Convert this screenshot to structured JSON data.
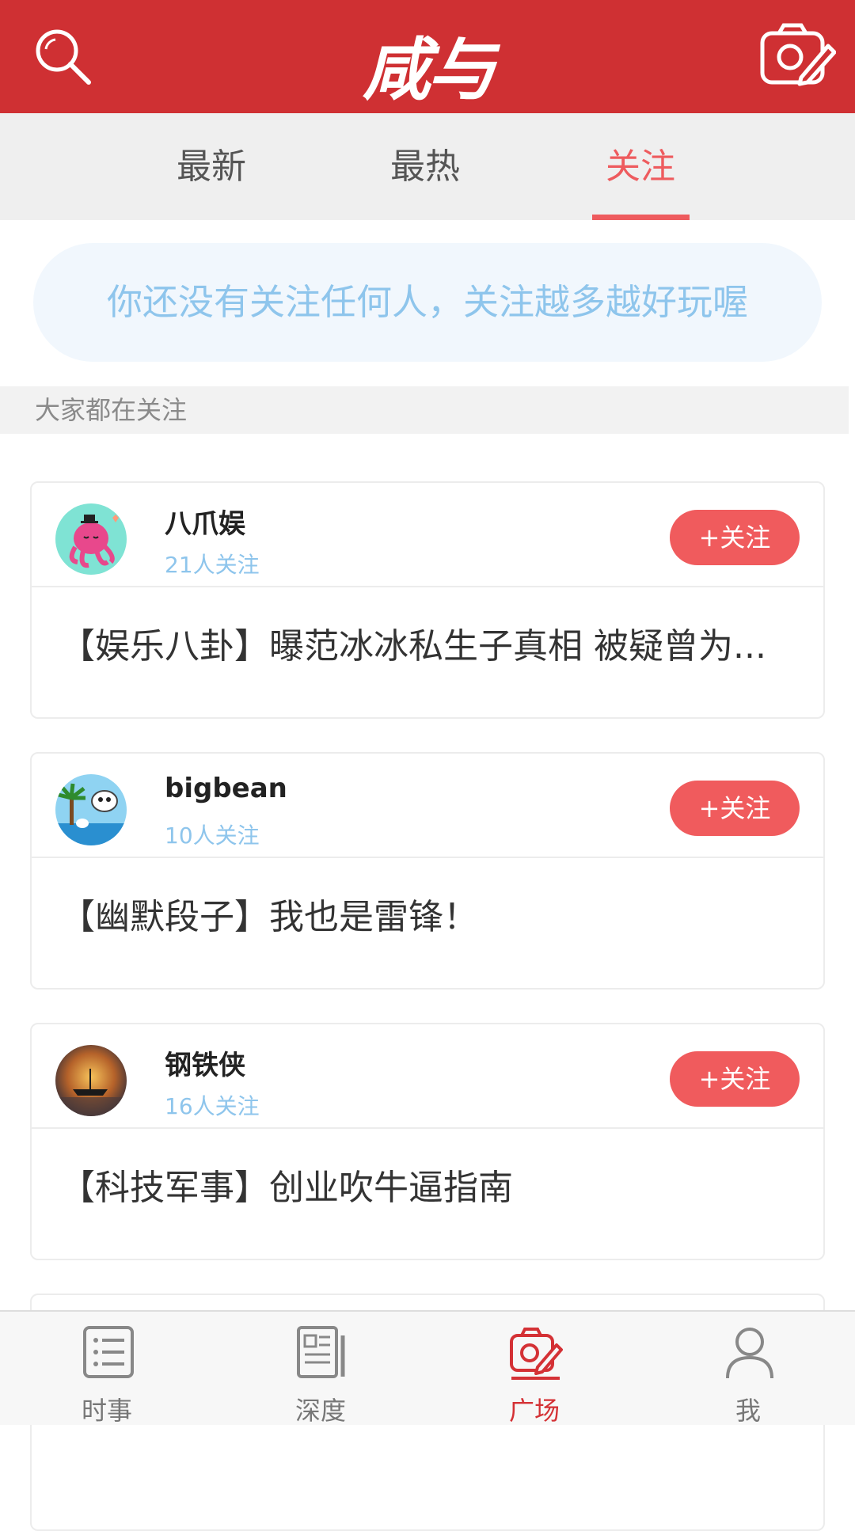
{
  "header": {
    "logo": "咸与",
    "search_icon": "search-icon",
    "camera_icon": "camera-edit-icon",
    "bg_color": "#cf3033"
  },
  "tabs": [
    {
      "label": "最新",
      "active": false
    },
    {
      "label": "最热",
      "active": false
    },
    {
      "label": "关注",
      "active": true
    }
  ],
  "hint": "你还没有关注任何人，关注越多越好玩喔",
  "section_title": "大家都在关注",
  "cards": [
    {
      "name": "八爪娱",
      "followers": "21人关注",
      "follow_label": "+关注",
      "title": "【娱乐八卦】曝范冰冰私生子真相 被疑曾为..."
    },
    {
      "name": "bigbean",
      "followers": "10人关注",
      "follow_label": "+关注",
      "title": "【幽默段子】我也是雷锋！"
    },
    {
      "name": "钢铁侠",
      "followers": "16人关注",
      "follow_label": "+关注",
      "title": "【科技军事】创业吹牛逼指南"
    }
  ],
  "bottom_nav": [
    {
      "label": "时事",
      "icon": "list-icon",
      "active": false
    },
    {
      "label": "深度",
      "icon": "newspaper-icon",
      "active": false
    },
    {
      "label": "广场",
      "icon": "camera-edit-icon",
      "active": true
    },
    {
      "label": "我",
      "icon": "user-icon",
      "active": false
    }
  ],
  "colors": {
    "accent": "#ee5b5e",
    "hint_text": "#8ec5ec",
    "follow_button": "#f05b5d"
  }
}
